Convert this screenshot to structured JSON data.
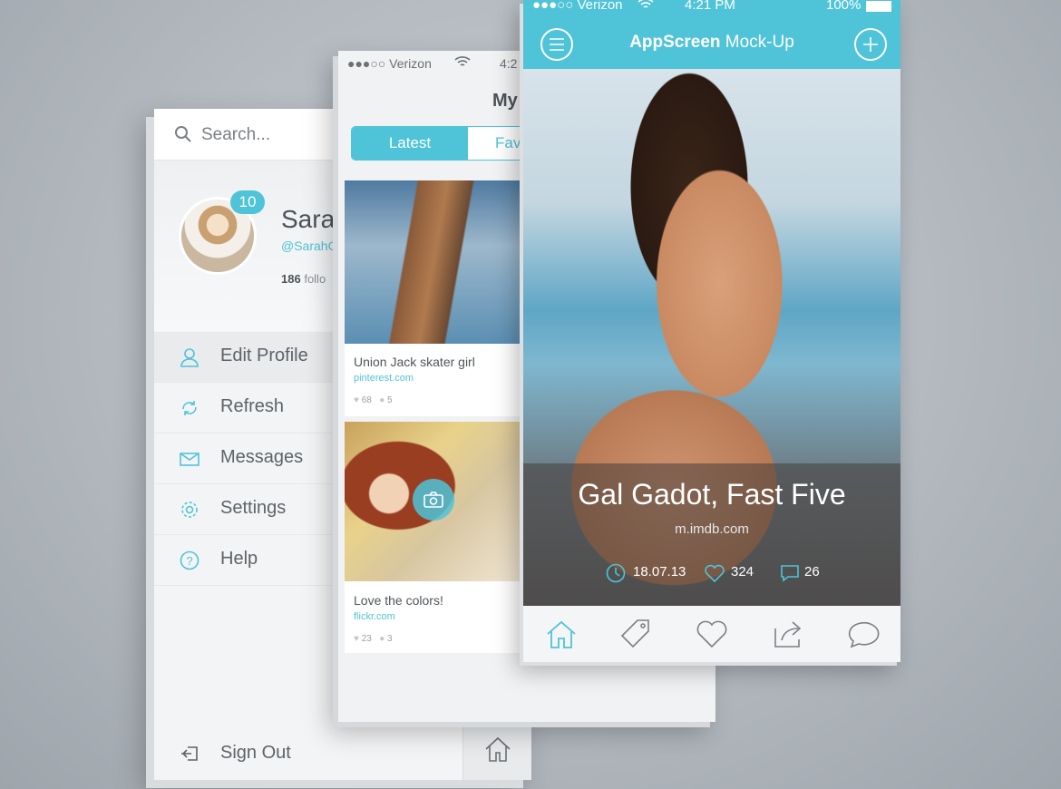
{
  "colors": {
    "accent": "#4fc3d8",
    "text": "#5d6368",
    "background": "#b8bec4"
  },
  "menu": {
    "search_placeholder": "Search...",
    "profile": {
      "name": "Saral",
      "handle": "@SarahC",
      "followers_count": "186",
      "followers_label": "follo",
      "badge": "10"
    },
    "items": [
      {
        "label": "Edit Profile",
        "icon": "user-icon"
      },
      {
        "label": "Refresh",
        "icon": "refresh-icon"
      },
      {
        "label": "Messages",
        "icon": "envelope-icon"
      },
      {
        "label": "Settings",
        "icon": "gear-icon"
      },
      {
        "label": "Help",
        "icon": "help-icon"
      }
    ],
    "sign_out": "Sign Out"
  },
  "feed": {
    "status": {
      "carrier": "●●●○○ Verizon",
      "time": "4:2"
    },
    "title": "My",
    "tabs": {
      "active": "Latest",
      "other": "Fav"
    },
    "cards": [
      {
        "title": "Union Jack skater girl",
        "source": "pinterest.com",
        "likes": "68",
        "comments": "5"
      },
      {
        "title": "Love the colors!",
        "source": "flickr.com",
        "likes": "23",
        "comments": "3"
      }
    ]
  },
  "detail": {
    "status": {
      "carrier": "●●●○○ Verizon",
      "time": "4:21 PM",
      "battery": "100%"
    },
    "app_title_bold": "AppScreen",
    "app_title_rest": " Mock-Up",
    "caption": "Gal Gadot, Fast Five",
    "source": "m.imdb.com",
    "date": "18.07.13",
    "likes": "324",
    "comments": "26"
  }
}
